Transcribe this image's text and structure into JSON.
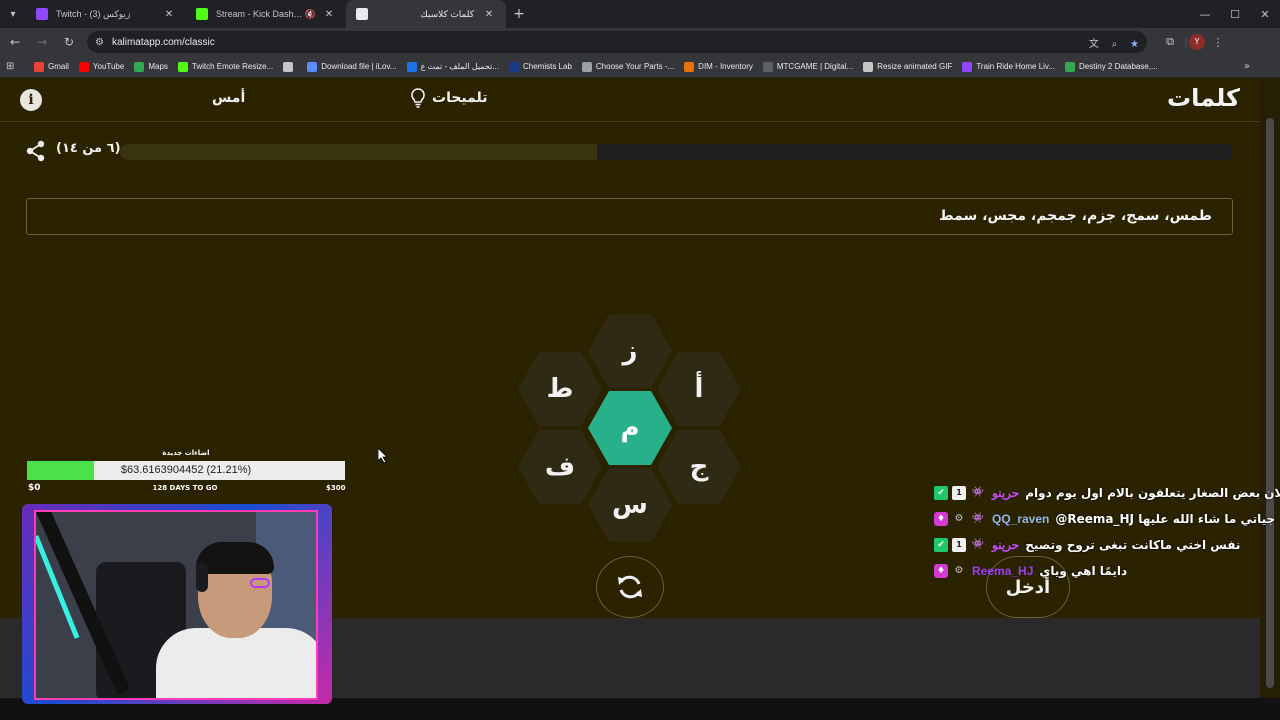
{
  "browser": {
    "tabs": [
      {
        "title": "Twitch - زيوكس (3)",
        "favicon_color": "#9147ff",
        "active": false
      },
      {
        "title": "Stream - Kick Dashboard",
        "favicon_color": "#53fc18",
        "active": false,
        "muted": true
      },
      {
        "title": "كلمات كلاسيك",
        "favicon_color": "#e8eaed",
        "active": true
      }
    ],
    "url": "kalimatapp.com/classic",
    "bookmarks": [
      {
        "label": "Gmail",
        "color": "#ea4335"
      },
      {
        "label": "YouTube",
        "color": "#ff0000"
      },
      {
        "label": "Maps",
        "color": "#34a853"
      },
      {
        "label": "Twitch Emote Resize...",
        "color": "#53fc18"
      },
      {
        "label": "",
        "color": "#c4c7c5"
      },
      {
        "label": "Download file | iLov...",
        "color": "#5b8cff"
      },
      {
        "label": "تحميل الملف - تمت ع...",
        "color": "#1a73e8"
      },
      {
        "label": "Chemists Lab",
        "color": "#1b3a8a"
      },
      {
        "label": "Choose Your Parts -...",
        "color": "#9aa0a6"
      },
      {
        "label": "DIM - Inventory",
        "color": "#e8710a"
      },
      {
        "label": "MTCGAME | Digital...",
        "color": "#5f6368"
      },
      {
        "label": "Resize animated GIF",
        "color": "#c4c7c5"
      },
      {
        "label": "Train Ride Home Liv...",
        "color": "#9147ff"
      },
      {
        "label": "Destiny 2 Database,...",
        "color": "#34a853"
      }
    ],
    "profile_initial": "Y"
  },
  "page": {
    "logo": "كلمات",
    "hints_label": "تلميحات",
    "yesterday_label": "أمس",
    "progress_label": "(٦ من ١٤)",
    "progress": {
      "found": 6,
      "total": 14
    },
    "found_words": "طمس، سمج، جزم، جمجم، مجس، سمط",
    "letters": {
      "center": "م",
      "top": "ز",
      "top_right": "أ",
      "bottom_right": "ج",
      "bottom": "س",
      "bottom_left": "ف",
      "top_left": "ط"
    },
    "enter_label": "أدخل"
  },
  "overlay": {
    "donation": {
      "title": "اضاءات جديدة",
      "value_text": "$63.6163904452 (21.21%)",
      "fraction": 0.2121,
      "min_label": "$0",
      "days_label": "128 DAYS TO GO",
      "max_label": "$300"
    },
    "chat": [
      {
        "badges": [
          "check",
          "sub",
          "bot"
        ],
        "name": "حرينو",
        "name_color": "#c24bff",
        "message": "لان بعض الصغار يتعلقون بالام اول يوم دوام"
      },
      {
        "badges": [
          "gem",
          "og",
          "bot"
        ],
        "name": "QQ_raven",
        "name_color": "#8fb7e8",
        "message": "@Reema_HJ جياتي ما شاء الله عليها"
      },
      {
        "badges": [
          "check",
          "sub",
          "bot"
        ],
        "name": "حرينو",
        "name_color": "#c24bff",
        "message": "نفس اختي ماكانت تبغى تروح وتصيح"
      },
      {
        "badges": [
          "gem",
          "og"
        ],
        "name": "Reema_HJ",
        "name_color": "#9b3bff",
        "message": "دايمًا اهي وياي"
      }
    ]
  }
}
